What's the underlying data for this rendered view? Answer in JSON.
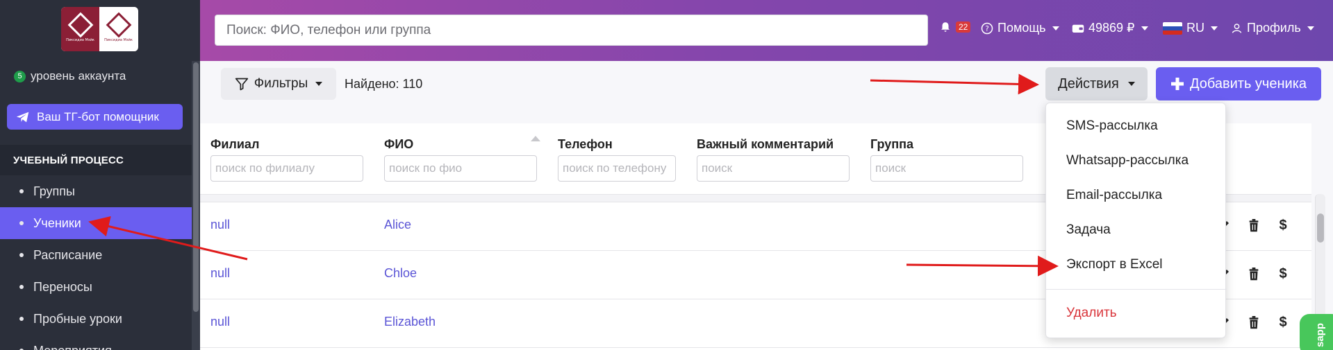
{
  "sidebar": {
    "logo_caption_left": "Пиксидиа Мэйк",
    "logo_caption_right": "Пиксидиа Мэйк",
    "account_level_number": "5",
    "account_level_text": "уровень аккаунта",
    "tg_bot_label": "Ваш ТГ-бот помощник",
    "section_title": "УЧЕБНЫЙ ПРОЦЕСС",
    "items": [
      {
        "label": "Группы",
        "active": false
      },
      {
        "label": "Ученики",
        "active": true
      },
      {
        "label": "Расписание",
        "active": false
      },
      {
        "label": "Переносы",
        "active": false
      },
      {
        "label": "Пробные уроки",
        "active": false
      },
      {
        "label": "Мероприятия",
        "active": false
      }
    ]
  },
  "header": {
    "search_placeholder": "Поиск: ФИО, телефон или группа",
    "notifications_count": "22",
    "help_label": "Помощь",
    "balance_label": "49869 ₽",
    "language_label": "RU",
    "profile_label": "Профиль"
  },
  "toolbar": {
    "filters_label": "Фильтры",
    "found_text": "Найдено: 110",
    "actions_label": "Действия",
    "add_student_label": "Добавить ученика"
  },
  "table": {
    "columns": [
      {
        "header": "Филиал",
        "placeholder": "поиск по филиалу"
      },
      {
        "header": "ФИО",
        "placeholder": "поиск по фио"
      },
      {
        "header": "Телефон",
        "placeholder": "поиск по телефону"
      },
      {
        "header": "Важный комментарий",
        "placeholder": "поиск"
      },
      {
        "header": "Группа",
        "placeholder": "поиск"
      }
    ],
    "rows": [
      {
        "branch": "null",
        "name": "Alice"
      },
      {
        "branch": "null",
        "name": "Chloe"
      },
      {
        "branch": "null",
        "name": "Elizabeth"
      }
    ]
  },
  "actions_menu": {
    "items": [
      {
        "label": "SMS-рассылка"
      },
      {
        "label": "Whatsapp-рассылка"
      },
      {
        "label": "Email-рассылка"
      },
      {
        "label": "Задача"
      },
      {
        "label": "Экспорт в Excel"
      }
    ],
    "delete_label": "Удалить"
  },
  "whatsapp_tab_label": "sapp",
  "colors": {
    "accent": "#6a5ef0",
    "sidebar_bg": "#2b2f3a",
    "danger": "#d9343a",
    "arrow": "#e01b1b"
  }
}
